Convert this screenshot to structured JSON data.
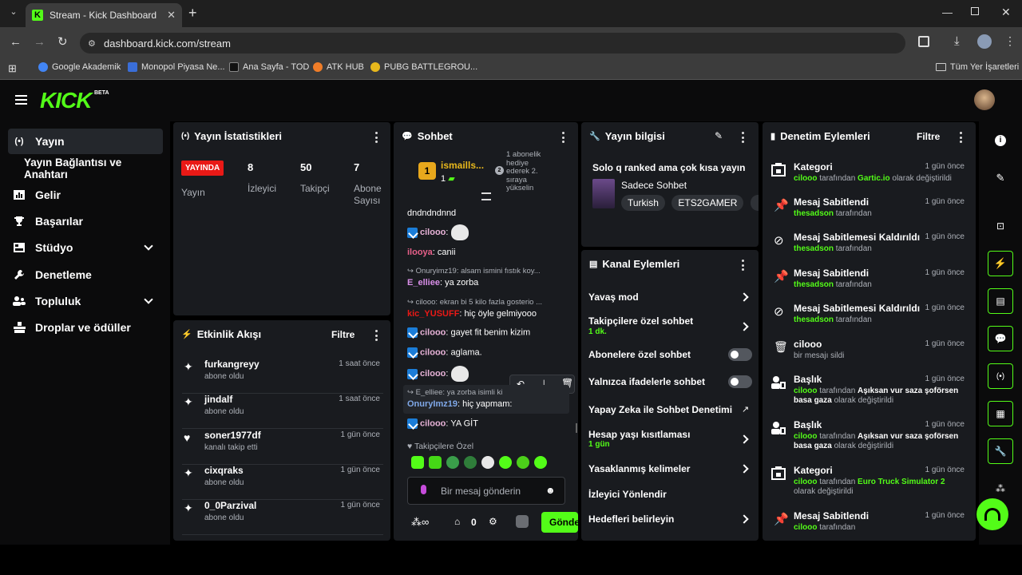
{
  "browser": {
    "tab_title": "Stream - Kick Dashboard",
    "url": "dashboard.kick.com/stream",
    "bookmarks": [
      "Google Akademik",
      "Monopol Piyasa Ne...",
      "Ana Sayfa - TOD",
      "ATK HUB",
      "PUBG BATTLEGROU..."
    ],
    "all_bookmarks": "Tüm Yer İşaretleri"
  },
  "header": {
    "logo": "KICK",
    "beta": "BETA"
  },
  "sidebar": {
    "items": [
      {
        "label": "Yayın",
        "icon": "broadcast-icon"
      },
      {
        "label": "Yayın Bağlantısı ve Anahtarı",
        "icon": ""
      },
      {
        "label": "Gelir",
        "icon": "revenue-icon"
      },
      {
        "label": "Başarılar",
        "icon": "trophy-icon"
      },
      {
        "label": "Stüdyo",
        "icon": "studio-icon"
      },
      {
        "label": "Denetleme",
        "icon": "wrench-icon"
      },
      {
        "label": "Topluluk",
        "icon": "people-icon"
      },
      {
        "label": "Droplar ve ödüller",
        "icon": "drops-icon"
      }
    ]
  },
  "stats": {
    "title": "Yayın İstatistikleri",
    "status": "YAYINDA",
    "status_label": "Yayın",
    "viewers": "8",
    "viewers_label": "İzleyici",
    "followers": "50",
    "followers_label": "Takipçi",
    "subs": "7",
    "subs_label1": "Abone",
    "subs_label2": "Sayısı"
  },
  "activity": {
    "title": "Etkinlik Akışı",
    "filter": "Filtre",
    "items": [
      {
        "name": "furkangreyy",
        "sub": "abone oldu",
        "when": "1 saat önce"
      },
      {
        "name": "jindalf",
        "sub": "abone oldu",
        "when": "1 saat önce"
      },
      {
        "name": "soner1977df",
        "sub": "kanalı takip etti",
        "when": "1 gün önce"
      },
      {
        "name": "cixqraks",
        "sub": "abone oldu",
        "when": "1 gün önce"
      },
      {
        "name": "0_0Parzival",
        "sub": "abone oldu",
        "when": "1 gün önce"
      }
    ]
  },
  "chat": {
    "title": "Sohbet",
    "gifter_name": "ismaills...",
    "gifter_rank": "1",
    "gifter_count": "1",
    "next_rank": "2",
    "gift_info": [
      "1 abonelik",
      "hediye",
      "ederek 2.",
      "sıraya",
      "yükselin"
    ],
    "messages": {
      "m1": "dndndndnnd",
      "u2": "cilooo",
      "u3": "ilooya",
      "t3": "canii",
      "r4": "Onuryimz19: alsam ismini fıstık koy...",
      "u4": "E_elliee",
      "t4": "ya zorba",
      "r5": "cilooo: ekran bi 5 kilo fazla gosterio ...",
      "u5": "kic_YUSUFF",
      "t5": "hiç öyle gelmiyooo",
      "u6": "cilooo",
      "t6": "gayet fit benim kizim",
      "u7": "cilooo",
      "t7": "aglama.",
      "u8": "cilooo",
      "r9": "E_elliee: ya zorba isimli ki",
      "u9": "OnuryImz19",
      "t9": "hiç yapmam:",
      "u10": "cilooo",
      "t10": "YA GİT"
    },
    "followers_only": "Takipçilere Özel",
    "input_placeholder": "Bir mesaj gönderin",
    "points": "0",
    "send": "Gönde"
  },
  "stream_info": {
    "title": "Yayın bilgisi",
    "stream_title": "Solo q ranked ama çok kısa yayın",
    "category": "Sadece Sohbet",
    "tags": [
      "Turkish",
      "ETS2GAMER"
    ]
  },
  "channel_actions": {
    "title": "Kanal Eylemleri",
    "slow_mode": "Yavaş mod",
    "followers_chat": "Takipçilere özel sohbet",
    "followers_chat_value": "1 dk.",
    "subs_chat": "Abonelere özel sohbet",
    "emote_chat": "Yalnızca ifadelerle sohbet",
    "ai_mod": "Yapay Zeka ile Sohbet Denetimi",
    "account_age": "Hesap yaşı kısıtlaması",
    "account_age_value": "1 gün",
    "banned_words": "Yasaklanmış kelimeler",
    "redirect": "İzleyici Yönlendir",
    "goals": "Hedefleri belirleyin"
  },
  "moderation": {
    "title": "Denetim Eylemleri",
    "filter": "Filtre",
    "items": [
      {
        "title": "Kategori",
        "user": "cilooo",
        "mid": " tarafından ",
        "value": "Gartic.io",
        "tail": " olarak değiştirildi",
        "when": "1 gün önce"
      },
      {
        "title": "Mesaj Sabitlendi",
        "user": "thesadson",
        "mid": " tarafından",
        "value": "",
        "tail": "",
        "when": "1 gün önce"
      },
      {
        "title": "Mesaj Sabitlemesi Kaldırıldı",
        "user": "thesadson",
        "mid": " tarafından",
        "value": "",
        "tail": "",
        "when": "1 gün önce"
      },
      {
        "title": "Mesaj Sabitlendi",
        "user": "thesadson",
        "mid": " tarafından",
        "value": "",
        "tail": "",
        "when": "1 gün önce"
      },
      {
        "title": "Mesaj Sabitlemesi Kaldırıldı",
        "user": "thesadson",
        "mid": " tarafından",
        "value": "",
        "tail": "",
        "when": "1 gün önce"
      },
      {
        "title": "cilooo",
        "user": "",
        "mid": "bir mesajı sildi",
        "value": "",
        "tail": "",
        "when": "1 gün önce"
      },
      {
        "title": "Başlık",
        "user": "cilooo",
        "mid": " tarafından ",
        "value": "Aşıksan vur saza şoförsen basa gaza",
        "tail": " olarak değiştirildi",
        "when": "1 gün önce"
      },
      {
        "title": "Başlık",
        "user": "cilooo",
        "mid": " tarafından ",
        "value": "Aşıksan vur saza şoförsen basa gaza",
        "tail": " olarak değiştirildi",
        "when": "1 gün önce"
      },
      {
        "title": "Kategori",
        "user": "cilooo",
        "mid": " tarafından ",
        "value": "Euro Truck Simulator 2",
        "tail": " olarak değiştirildi",
        "when": "1 gün önce"
      },
      {
        "title": "Mesaj Sabitlendi",
        "user": "cilooo",
        "mid": " tarafından",
        "value": "",
        "tail": "",
        "when": "1 gün önce"
      }
    ]
  },
  "colors": {
    "accent": "#53fc18",
    "live": "#e91916",
    "panel": "#191b1f",
    "bg": "#000000"
  }
}
